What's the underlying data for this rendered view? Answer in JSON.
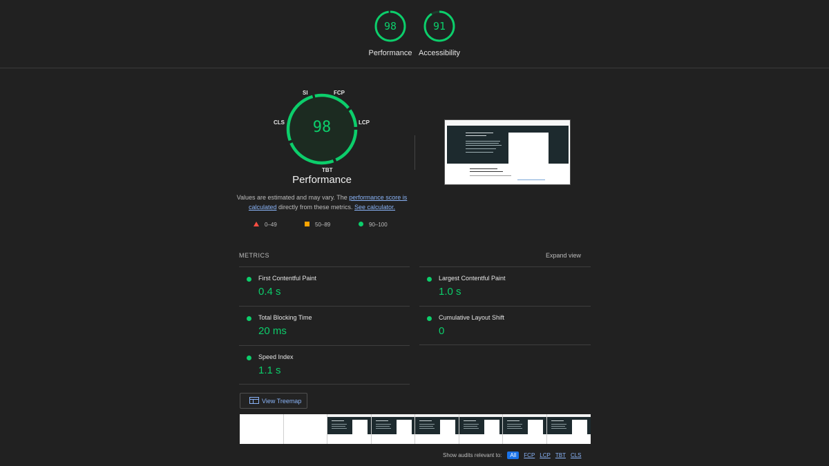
{
  "header": {
    "gauges": [
      {
        "score": "98",
        "label": "Performance"
      },
      {
        "score": "91",
        "label": "Accessibility"
      }
    ]
  },
  "performance": {
    "score": "98",
    "title": "Performance",
    "metric_labels": {
      "st": "SI",
      "fcp": "FCP",
      "lcp": "LCP",
      "tbt": "TBT",
      "cls": "CLS"
    },
    "description": {
      "text1": "Values are estimated and may vary. The ",
      "link1": "performance score is calculated",
      "text2": " directly from these metrics. ",
      "link2": "See calculator."
    },
    "legend": [
      {
        "range": "0–49",
        "color": "#ff4e42",
        "shape": "triangle"
      },
      {
        "range": "50–89",
        "color": "#ffa400",
        "shape": "square"
      },
      {
        "range": "90–100",
        "color": "#0cce6b",
        "shape": "circle"
      }
    ],
    "pass_color": "#0cce6b"
  },
  "metrics": {
    "heading": "METRICS",
    "expand_label": "Expand view",
    "items": [
      {
        "name": "First Contentful Paint",
        "value": "0.4 s"
      },
      {
        "name": "Largest Contentful Paint",
        "value": "1.0 s"
      },
      {
        "name": "Total Blocking Time",
        "value": "20 ms"
      },
      {
        "name": "Cumulative Layout Shift",
        "value": "0"
      },
      {
        "name": "Speed Index",
        "value": "1.1 s"
      }
    ]
  },
  "treemap": {
    "label": "View Treemap",
    "icon": "treemap-icon"
  },
  "audits_filter": {
    "label": "Show audits relevant to:",
    "options": [
      "All",
      "FCP",
      "LCP",
      "TBT",
      "CLS"
    ],
    "selected": "All"
  }
}
